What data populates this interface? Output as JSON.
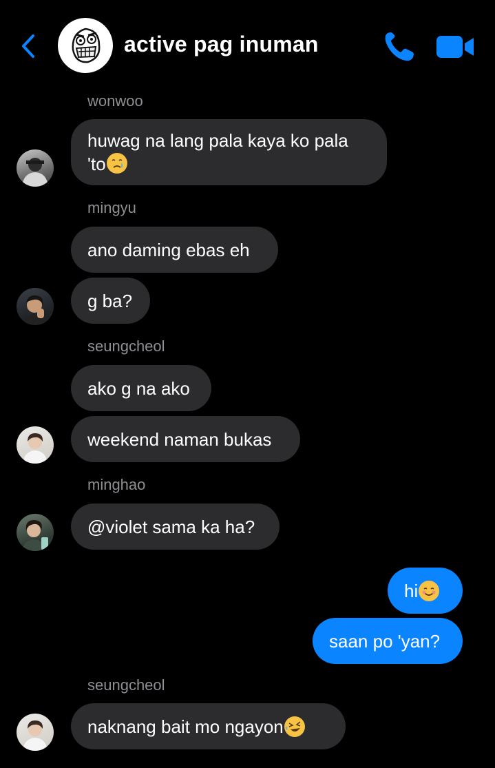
{
  "header": {
    "title": "active pag inuman"
  },
  "messages": {
    "wonwoo": {
      "sender": "wonwoo",
      "line1": "huwag na lang pala kaya ko pala",
      "line2": "'to"
    },
    "mingyu": {
      "sender": "mingyu",
      "text1": "ano daming ebas eh",
      "text2": "g ba?"
    },
    "seungcheol1": {
      "sender": "seungcheol",
      "text1": "ako g na ako",
      "text2": "weekend naman bukas"
    },
    "minghao": {
      "sender": "minghao",
      "text1": "@violet sama ka ha?"
    },
    "me": {
      "text1": "hi",
      "text2": "saan po 'yan?"
    },
    "seungcheol2": {
      "sender": "seungcheol",
      "text1": "naknang bait mo ngayon"
    }
  },
  "emojis": {
    "wonwoo": "crying-face-emoji",
    "me": "smiling-face-emoji",
    "seungcheol2": "rolling-laughing-emoji"
  },
  "colors": {
    "accent": "#0a84ff",
    "incoming_bubble": "#2c2c2e",
    "outgoing_bubble": "#0a84ff",
    "sender_label": "#8e8e93",
    "background": "#000000"
  }
}
